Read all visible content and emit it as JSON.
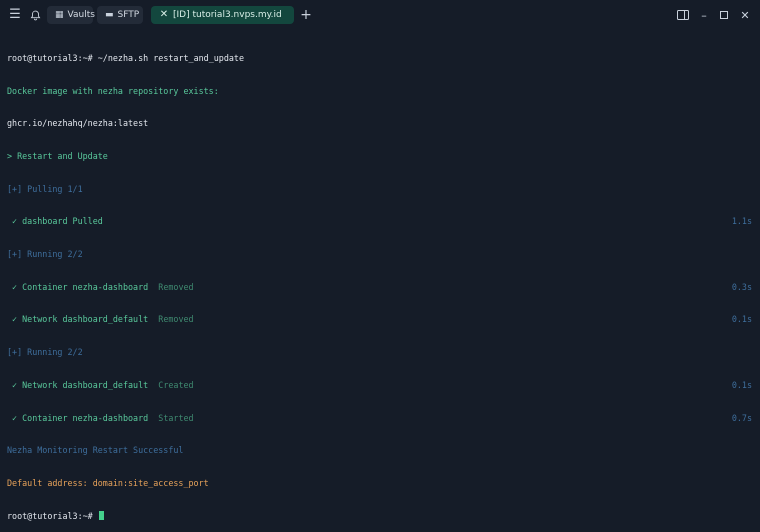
{
  "titlebar": {
    "tabs": [
      {
        "label": "Vaults",
        "icon": "vault-icon"
      },
      {
        "label": "SFTP",
        "icon": "folder-icon"
      },
      {
        "label": "[ID] tutorial3.nvps.my.id",
        "icon": "close-icon",
        "active": true
      }
    ],
    "new_tab_icon": "plus-icon"
  },
  "terminal": {
    "line1_prompt": "root@tutorial3:~# ",
    "line1_cmd": "~/nezha.sh restart_and_update",
    "line2": "Docker image with nezha repository exists:",
    "line3": "ghcr.io/nezhahq/nezha:latest",
    "line4": "> Restart and Update",
    "line5": "[+] Pulling 1/1",
    "line6_main": " ✓ dashboard Pulled",
    "line6_time": "1.1s",
    "line7": "[+] Running 2/2",
    "line8_main": " ✓ Container nezha-dashboard",
    "line8_status": "Removed",
    "line8_time": "0.3s",
    "line9_main": " ✓ Network dashboard_default",
    "line9_status": "Removed",
    "line9_time": "0.1s",
    "line10": "[+] Running 2/2",
    "line11_main": " ✓ Network dashboard_default",
    "line11_status": "Created",
    "line11_time": "0.1s",
    "line12_main": " ✓ Container nezha-dashboard",
    "line12_status": "Started",
    "line12_time": "0.7s",
    "line13": "Nezha Monitoring Restart Successful",
    "line14": "Default address: domain:site_access_port",
    "line15_prompt": "root@tutorial3:~# "
  },
  "colors": {
    "background": "#151c28",
    "active_tab": "#13473e",
    "green": "#59c89b",
    "blue": "#3e6e9c",
    "orange": "#e7a25a",
    "cursor": "#44d08c"
  }
}
